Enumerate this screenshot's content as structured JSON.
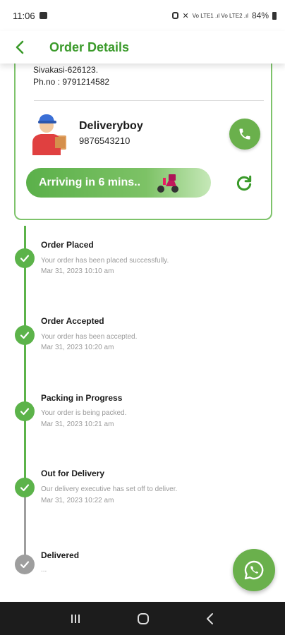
{
  "status_bar": {
    "time": "11:06",
    "battery": "84%",
    "network": "Vo LTE1 .ıl Vo LTE2 .ıl"
  },
  "header": {
    "title": "Order Details"
  },
  "address": {
    "line": "Sivakasi-626123.",
    "phone": "Ph.no : 9791214582"
  },
  "delivery": {
    "name": "Deliveryboy",
    "phone": "9876543210",
    "eta": "Arriving  in 6 mins.."
  },
  "timeline": [
    {
      "title": "Order Placed",
      "desc": "Your order has been placed successfully.",
      "time": "Mar 31, 2023 10:10 am",
      "done": true
    },
    {
      "title": "Order Accepted",
      "desc": "Your order has been accepted.",
      "time": "Mar 31, 2023 10:20 am",
      "done": true
    },
    {
      "title": "Packing in Progress",
      "desc": "Your order is being packed.",
      "time": "Mar 31, 2023 10:21 am",
      "done": true
    },
    {
      "title": "Out for Delivery",
      "desc": "Our delivery executive has set off to deliver.",
      "time": "Mar 31, 2023 10:22 am",
      "done": true
    },
    {
      "title": "Delivered",
      "desc": "...",
      "time": "",
      "done": false
    }
  ],
  "colors": {
    "accent": "#3a9a2a",
    "button": "#6ab04c",
    "pending": "#9e9e9e"
  },
  "icons": {
    "back": "chevron-left-icon",
    "call": "phone-icon",
    "refresh": "refresh-icon",
    "whatsapp": "whatsapp-icon",
    "check": "check-icon"
  }
}
